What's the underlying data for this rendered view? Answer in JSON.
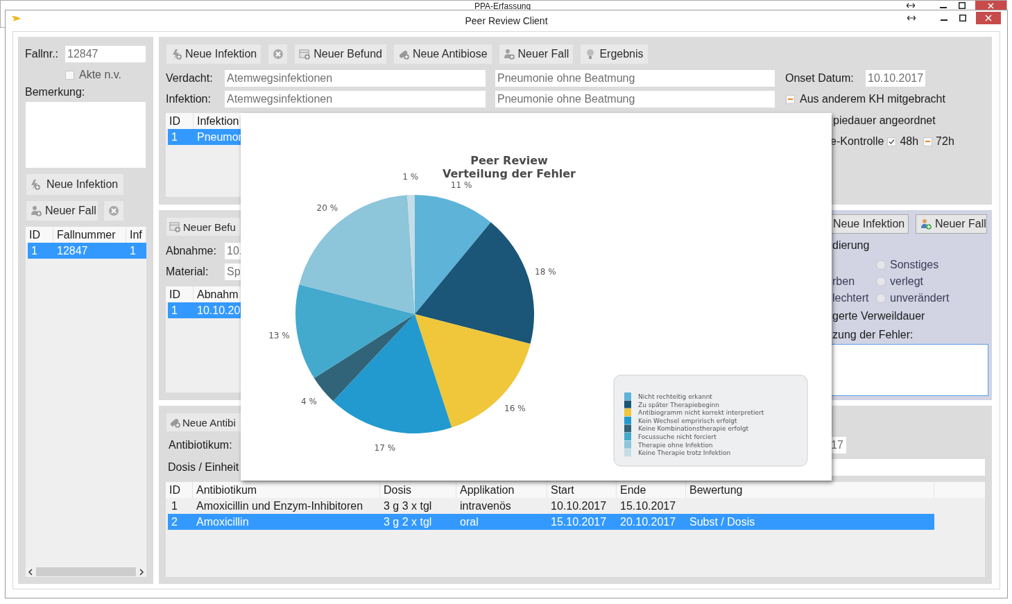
{
  "background_window": {
    "title": "PPA-Erfassung"
  },
  "window": {
    "title": "Peer Review Client"
  },
  "case_panel": {
    "fallnr_label": "Fallnr.:",
    "fallnr": "12847",
    "akte": {
      "label": "Akte n.v.",
      "checked": false
    },
    "bemerkung_label": "Bemerkung:",
    "buttons": [
      {
        "kind": "add-infection",
        "label": "Neue Infektion"
      },
      {
        "kind": "add-case",
        "label": "Neuer Fall"
      },
      {
        "kind": "delete"
      }
    ],
    "table": {
      "columns": [
        "ID",
        "Fallnummer",
        "Inf"
      ],
      "rows": [
        {
          "cells": [
            "1",
            "12847",
            "1"
          ],
          "selected": true
        }
      ]
    }
  },
  "infection_panel": {
    "toolbar": [
      {
        "kind": "add-infection",
        "label": "Neue Infektion"
      },
      {
        "kind": "delete"
      },
      {
        "kind": "add-finding",
        "label": "Neuer Befund"
      },
      {
        "kind": "add-antibiotic",
        "label": "Neue Antibiose"
      },
      {
        "kind": "add-case",
        "label": "Neuer Fall"
      },
      {
        "kind": "result",
        "label": "Ergebnis"
      }
    ],
    "fields": [
      {
        "label": "Verdacht:",
        "values": [
          "Atemwegsinfektionen",
          "Pneumonie ohne Beatmung"
        ]
      },
      {
        "label": "Infektion:",
        "values": [
          "Atemwegsinfektionen",
          "Pneumonie ohne Beatmung"
        ]
      }
    ],
    "table": {
      "columns": [
        "ID",
        "Infektion"
      ],
      "rows": [
        {
          "cells": [
            "1",
            "Pneumor"
          ],
          "selected": true
        }
      ]
    },
    "onset": {
      "label": "Onset Datum:",
      "value": "10.10.2017"
    },
    "options": [
      {
        "kind": "checkbox",
        "label": "Aus anderem KH mitgebracht",
        "indeterminate": true
      },
      {
        "kind": "text",
        "label": "piedauer angeordnet"
      },
      {
        "kind": "check_group",
        "label": "e-Kontrolle",
        "checks": [
          {
            "label": "48h",
            "checked": true
          },
          {
            "label": "72h",
            "indeterminate": true
          }
        ]
      }
    ]
  },
  "finding_panel": {
    "button": {
      "kind": "add-finding",
      "label": "Neuer Befu"
    },
    "fields": [
      {
        "label": "Abnahme:",
        "value": "10."
      },
      {
        "label": "Material:",
        "value": "Sp"
      }
    ],
    "table": {
      "columns": [
        "ID",
        "Abnahm"
      ],
      "rows": [
        {
          "cells": [
            "1",
            "10.10.20"
          ],
          "selected": true
        }
      ]
    }
  },
  "outcome_panel": {
    "buttons": [
      {
        "label": "Neue Infektion"
      },
      {
        "kind": "add-case",
        "label": "Neuer Fall"
      }
    ],
    "heading": "dierung",
    "radios": [
      {
        "label": "Sonstiges",
        "selected": false
      },
      {
        "side_text": "rben",
        "label": "verlegt",
        "selected": false
      },
      {
        "side_text": "lechtert",
        "label": "unverändert",
        "selected": false
      }
    ],
    "lines": [
      "gerte Verweildauer",
      "zung der Fehler:"
    ],
    "comment": {
      "focused": true
    }
  },
  "antibiotic_panel": {
    "button": {
      "kind": "add-antibiotic",
      "label": "Neue Antibi"
    },
    "fields": [
      {
        "label": "Antibiotikum:",
        "value": "17"
      },
      {
        "label": "Dosis / Einheit"
      }
    ],
    "table": {
      "columns": [
        "ID",
        "Antibiotikum",
        "Dosis",
        "Applikation",
        "Start",
        "Ende",
        "Bewertung"
      ],
      "rows": [
        {
          "cells": [
            "1",
            "Amoxicillin und Enzym-Inhibitoren",
            "3 g 3 x tgl",
            "intravenös",
            "10.10.2017",
            "15.10.2017"
          ],
          "selected": false
        },
        {
          "cells": [
            "2",
            "Amoxicillin",
            "3 g 2 x tgl",
            "oral",
            "15.10.2017",
            "20.10.2017",
            "Subst / Dosis"
          ],
          "selected": true
        }
      ]
    }
  },
  "chart_popup": {
    "chart_data": {
      "type": "pie",
      "title": "Peer Review\nVerteilung der Fehler",
      "categories": [
        "Nicht rechteitig erkannt",
        "Zu später Therapiebeginn",
        "Antibiogramm nicht korrekt interpretiert",
        "Kein Wechsel empririsch erfolgt",
        "Keine Kombinationstherapie erfolgt",
        "Focussuche nicht forciert",
        "Therapie ohne Infektion",
        "Keine Therapie trotz Infektion"
      ],
      "values": [
        11,
        18,
        16,
        17,
        4,
        13,
        20,
        1
      ],
      "data_labels": true,
      "legend": "lower right",
      "value_labels": [
        "11 %",
        "18 %",
        "16 %",
        "17 %",
        "4 %",
        "13 %",
        "20 %",
        "1 %"
      ],
      "colors": [
        "#5eb3d9",
        "#1b5577",
        "#f0c63a",
        "#229acf",
        "#316478",
        "#43a9cd",
        "#8dc5da",
        "#c4dde7"
      ]
    }
  }
}
